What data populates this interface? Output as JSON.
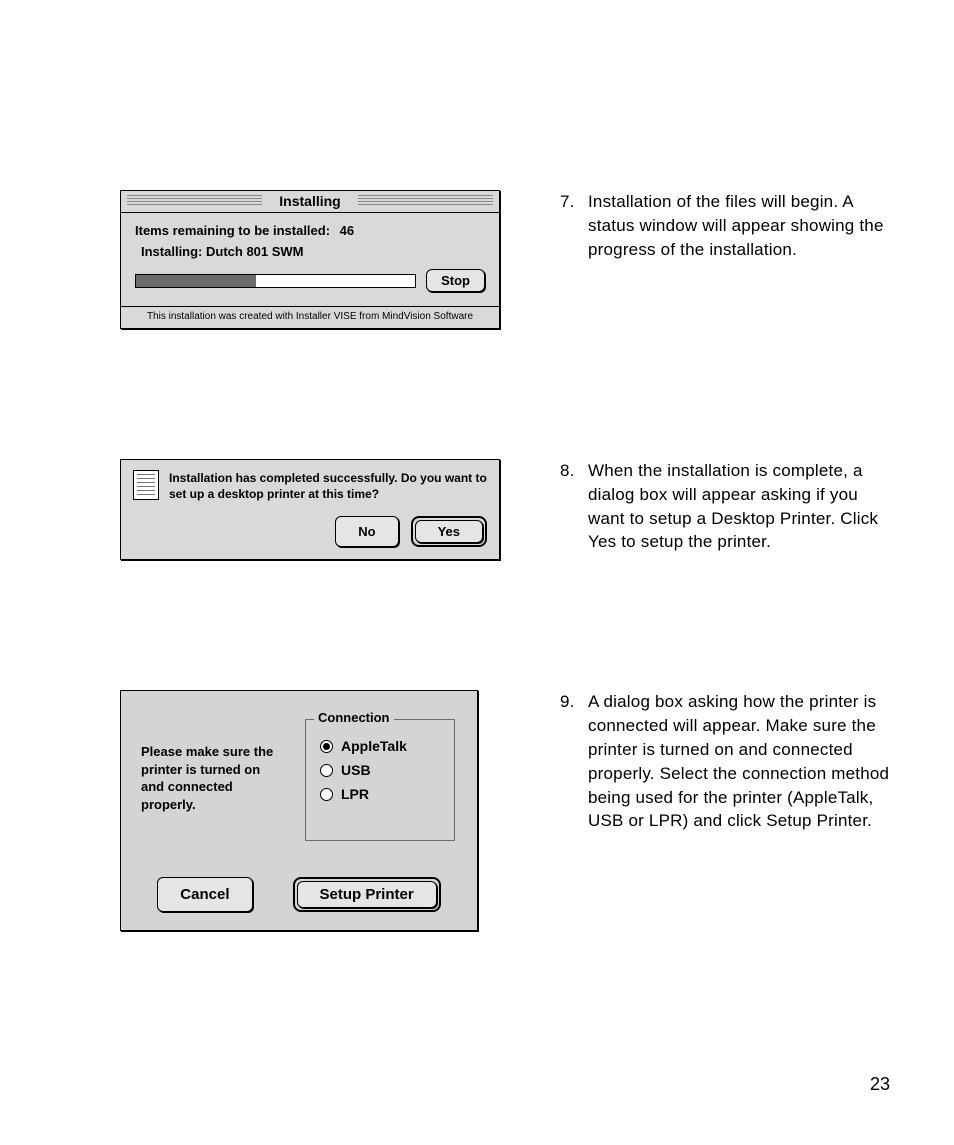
{
  "steps": {
    "s7": {
      "num": "7.",
      "text": "Installation of the files will begin. A status window will appear showing the progress of the installation."
    },
    "s8": {
      "num": "8.",
      "text": "When the installation is complete, a dialog box will appear asking if you want to setup a Desktop Printer. Click Yes to setup the printer."
    },
    "s9": {
      "num": "9.",
      "text": "A dialog box asking how the printer is connected will appear. Make sure the printer is turned on and connected properly. Select the connection method being used for the printer (AppleTalk, USB or LPR) and click Setup Printer."
    }
  },
  "dlg1": {
    "title": "Installing",
    "remaining_label": "Items remaining to be installed:",
    "remaining_count": "46",
    "installing_label": "Installing: Dutch 801 SWM",
    "stop": "Stop",
    "footer": "This installation was created with Installer VISE from MindVision Software"
  },
  "dlg2": {
    "message": "Installation has completed successfully. Do you want to set up a desktop printer at this time?",
    "no": "No",
    "yes": "Yes"
  },
  "dlg3": {
    "message": "Please make sure the printer is turned on and connected properly.",
    "group": "Connection",
    "opt1": "AppleTalk",
    "opt2": "USB",
    "opt3": "LPR",
    "cancel": "Cancel",
    "setup": "Setup Printer"
  },
  "page_number": "23"
}
